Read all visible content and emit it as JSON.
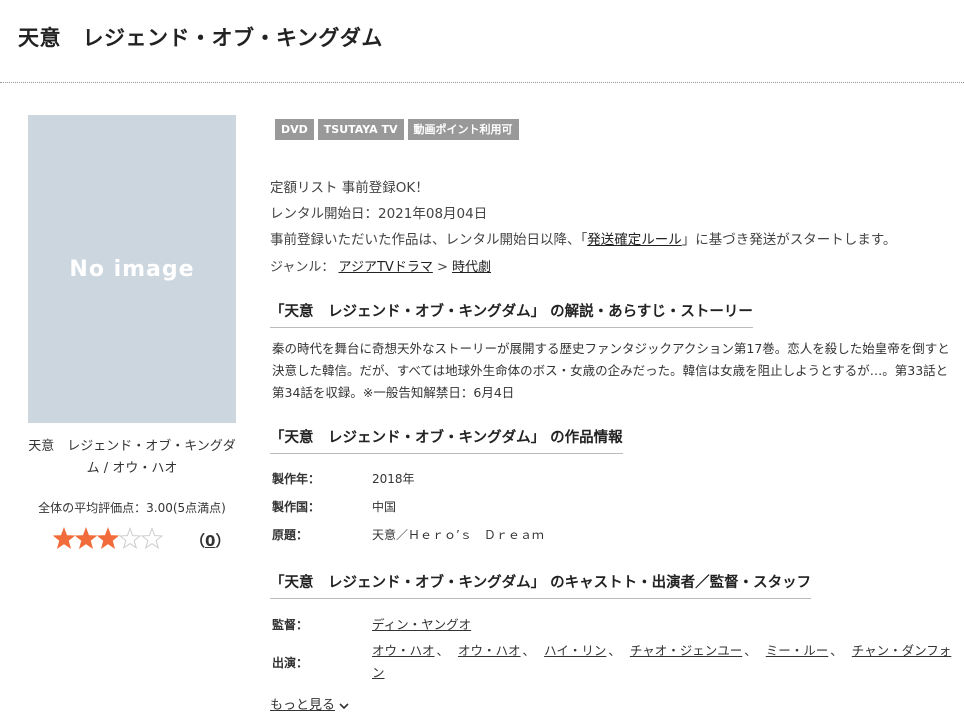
{
  "page": {
    "title": "天意　レジェンド・オブ・キングダム"
  },
  "left": {
    "image_placeholder": "No image",
    "product_name": "天意　レジェンド・オブ・キングダム / オウ・ハオ",
    "average_rating_text": "全体の平均評価点：3.00(5点満点)",
    "rating_value": 3,
    "rating_max": 5,
    "review_count_open": "（",
    "review_count": "0",
    "review_count_close": "）"
  },
  "badges": [
    "DVD",
    "TSUTAYA TV",
    "動画ポイント利用可"
  ],
  "info": {
    "list_note": "定額リスト 事前登録OK！",
    "rental_start": "レンタル開始日：2021年08月04日",
    "shipping_pre": "事前登録いただいた作品は、レンタル開始日以降、「",
    "shipping_link": "発送確定ルール",
    "shipping_post": "」に基づき発送がスタートします。",
    "genre_label": "ジャンル：",
    "genre_main": "アジアTVドラマ",
    "genre_sep": ">",
    "genre_sub": "時代劇"
  },
  "synopsis": {
    "heading": "「天意　レジェンド・オブ・キングダム」 の解説・あらすじ・ストーリー",
    "text": "秦の時代を舞台に奇想天外なストーリーが展開する歴史ファンタジックアクション第17巻。恋人を殺した始皇帝を倒すと決意した韓信。だが、すべては地球外生命体のボス・女歳の企みだった。韓信は女歳を阻止しようとするが…。第33話と第34話を収録。※一般告知解禁日：6月4日"
  },
  "work_info": {
    "heading": "「天意　レジェンド・オブ・キングダム」 の作品情報",
    "rows": [
      {
        "label": "製作年：",
        "value": "2018年"
      },
      {
        "label": "製作国：",
        "value": "中国"
      },
      {
        "label": "原題：",
        "value": "天意／Ｈｅｒｏ’ｓ　Ｄｒｅａｍ"
      }
    ]
  },
  "cast": {
    "heading": "「天意　レジェンド・オブ・キングダム」 のキャストト・出演者／監督・スタッフ",
    "director_label": "監督：",
    "director": "ディン・ヤングオ",
    "cast_label": "出演：",
    "cast_list": [
      "オウ・ハオ",
      "オウ・ハオ",
      "ハイ・リン",
      "チャオ・ジェンユー",
      "ミー・ルー",
      "チャン・ダンフォン"
    ],
    "separator": "、",
    "more": "もっと見る"
  },
  "colors": {
    "placeholder_bg": "#ccd6df",
    "badge_bg": "#999999",
    "star_on": "#f26b3a",
    "star_off": "#cccccc"
  }
}
